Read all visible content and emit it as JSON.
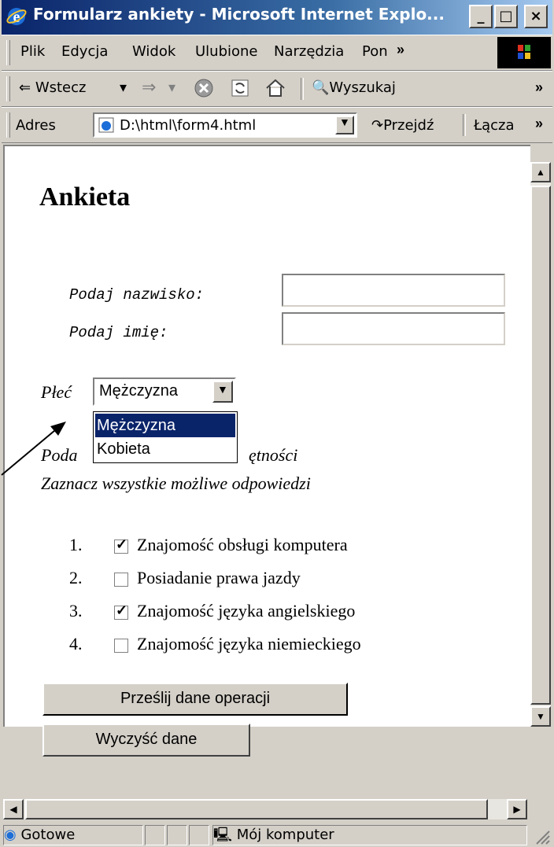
{
  "window": {
    "title": "Formularz ankiety - Microsoft Internet Explo...",
    "minimize": "_",
    "maximize": "□",
    "close": "×"
  },
  "menu": {
    "items": [
      "Plik",
      "Edycja",
      "Widok",
      "Ulubione",
      "Narzędzia",
      "Pon"
    ],
    "more": "»"
  },
  "toolbar": {
    "back": "Wstecz",
    "search": "Wyszukaj",
    "more": "»"
  },
  "address": {
    "label": "Adres",
    "value": "D:\\html\\form4.html",
    "go": "Przejdź",
    "links": "Łącza",
    "more": "»"
  },
  "page": {
    "heading": "Ankieta",
    "surname_label": "Podaj nazwisko:",
    "firstname_label": "Podaj imię:",
    "gender_label": "Płeć",
    "gender_selected": "Mężczyzna",
    "gender_options": [
      "Mężczyzna",
      "Kobieta"
    ],
    "skills_label_partial": "Poda",
    "skills_label_tail": "ętności",
    "skills_hint": "Zaznacz wszystkie możliwe odpowiedzi",
    "checklist": [
      {
        "num": "1.",
        "label": "Znajomość obsługi komputera",
        "checked": true
      },
      {
        "num": "2.",
        "label": "Posiadanie prawa jazdy",
        "checked": false
      },
      {
        "num": "3.",
        "label": "Znajomość języka angielskiego",
        "checked": true
      },
      {
        "num": "4.",
        "label": "Znajomość języka niemieckiego",
        "checked": false
      }
    ],
    "submit": "Prześlij dane operacji",
    "reset": "Wyczyść dane"
  },
  "status": {
    "text": "Gotowe",
    "zone": "Mój komputer"
  }
}
